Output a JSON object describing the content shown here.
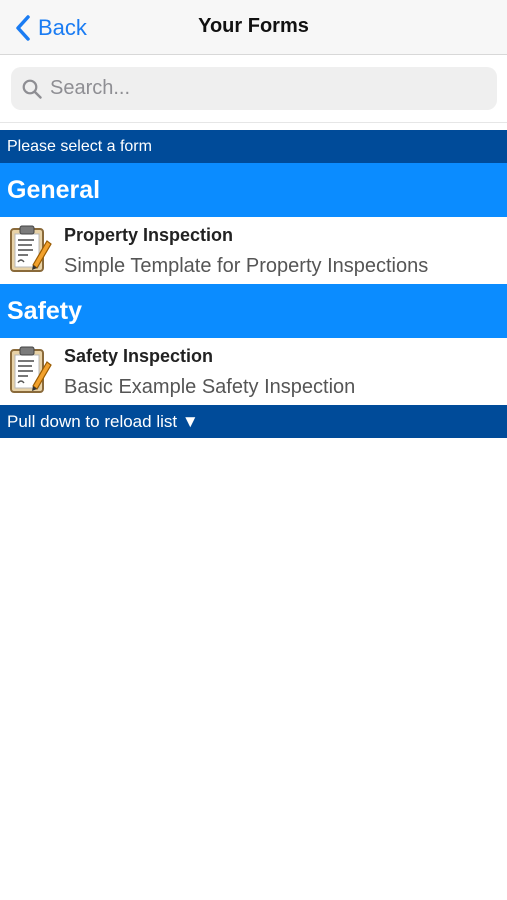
{
  "nav": {
    "back_label": "Back",
    "title": "Your Forms"
  },
  "search": {
    "placeholder": "Search..."
  },
  "list": {
    "top_banner": "Please select a form",
    "sections": [
      {
        "header": "General",
        "forms": [
          {
            "title": "Property Inspection",
            "description": "Simple Template for Property Inspections",
            "icon": "clipboard-pencil-icon"
          }
        ]
      },
      {
        "header": "Safety",
        "forms": [
          {
            "title": "Safety Inspection",
            "description": "Basic Example Safety Inspection",
            "icon": "clipboard-pencil-icon"
          }
        ]
      }
    ],
    "footer_banner": "Pull down to reload list ▼"
  },
  "colors": {
    "nav_tint": "#1a7cf3",
    "banner_dark_blue": "#004b99",
    "section_blue": "#0b8cff"
  }
}
